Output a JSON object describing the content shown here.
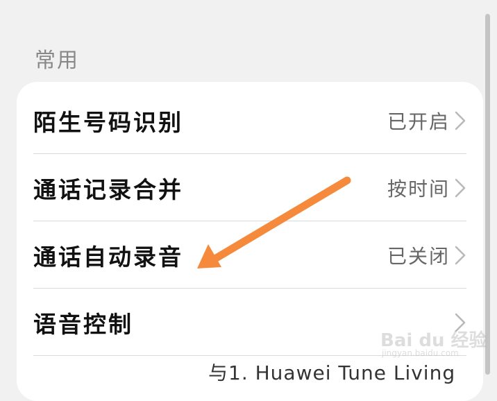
{
  "section": {
    "header": "常用"
  },
  "settings": [
    {
      "title": "陌生号码识别",
      "value": "已开启"
    },
    {
      "title": "通话记录合并",
      "value": "按时间"
    },
    {
      "title": "通话自动录音",
      "value": "已关闭"
    },
    {
      "title": "语音控制",
      "value": ""
    }
  ],
  "overlay": {
    "caption": "与1. Huawei Tune Living"
  },
  "watermark": {
    "brand": "Bai du 经验",
    "url": "jingyan.baidu.com"
  },
  "colors": {
    "background": "#f1f1f1",
    "card": "#ffffff",
    "arrow": "#f58a3c",
    "divider": "#d9d9d9"
  },
  "icons": {
    "chevron": "chevron-right-icon",
    "annotation": "orange-arrow-annotation"
  }
}
